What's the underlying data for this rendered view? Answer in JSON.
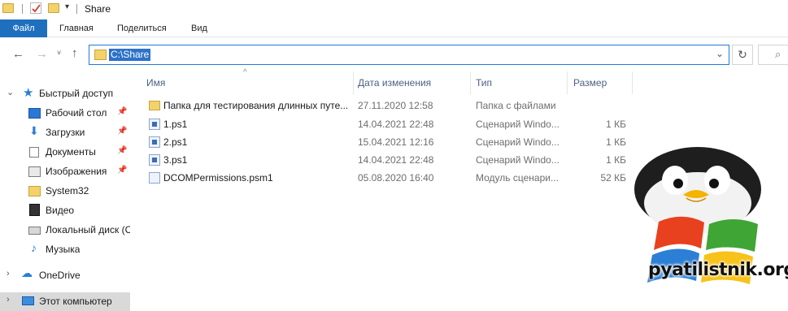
{
  "window": {
    "title": "Share"
  },
  "ribbon": {
    "tabs": [
      "Файл",
      "Главная",
      "Поделиться",
      "Вид"
    ]
  },
  "address_bar": {
    "path": "C:\\Share"
  },
  "icons": {
    "back": "back-arrow-icon",
    "forward": "forward-arrow-icon",
    "recent": "chevron-down-icon",
    "up": "up-arrow-icon",
    "refresh": "refresh-icon",
    "search": "search-icon"
  },
  "sidebar": {
    "items": [
      {
        "label": "Быстрый доступ",
        "icon": "star-icon"
      },
      {
        "label": "Рабочий стол",
        "icon": "desktop-icon",
        "pinned": true
      },
      {
        "label": "Загрузки",
        "icon": "download-icon",
        "pinned": true
      },
      {
        "label": "Документы",
        "icon": "documents-icon",
        "pinned": true
      },
      {
        "label": "Изображения",
        "icon": "pictures-icon",
        "pinned": true
      },
      {
        "label": "System32",
        "icon": "folder-icon"
      },
      {
        "label": "Видео",
        "icon": "video-icon"
      },
      {
        "label": "Локальный диск (С",
        "icon": "disk-icon"
      },
      {
        "label": "Музыка",
        "icon": "music-icon"
      },
      {
        "label": "OneDrive",
        "icon": "cloud-icon"
      },
      {
        "label": "Этот компьютер",
        "icon": "computer-icon"
      }
    ]
  },
  "columns": [
    "Имя",
    "Дата изменения",
    "Тип",
    "Размер"
  ],
  "files": [
    {
      "name": "Папка для тестирования длинных путе...",
      "date": "27.11.2020 12:58",
      "type": "Папка с файлами",
      "size": "",
      "icon": "folder-icon"
    },
    {
      "name": "1.ps1",
      "date": "14.04.2021 22:48",
      "type": "Сценарий Windo...",
      "size": "1 КБ",
      "icon": "powershell-script-icon"
    },
    {
      "name": "2.ps1",
      "date": "15.04.2021 12:16",
      "type": "Сценарий Windo...",
      "size": "1 КБ",
      "icon": "powershell-script-icon"
    },
    {
      "name": "3.ps1",
      "date": "14.04.2021 22:48",
      "type": "Сценарий Windo...",
      "size": "1 КБ",
      "icon": "powershell-script-icon"
    },
    {
      "name": "DCOMPermissions.psm1",
      "date": "05.08.2020 16:40",
      "type": "Модуль сценари...",
      "size": "52 КБ",
      "icon": "powershell-module-icon"
    }
  ],
  "watermark": {
    "text": "pyatilistnik.org"
  },
  "colors": {
    "file_tab": "#1f6fbf",
    "selection": "#2d72c9",
    "address_border": "#1f7cd4",
    "column_header": "#4d6082"
  }
}
